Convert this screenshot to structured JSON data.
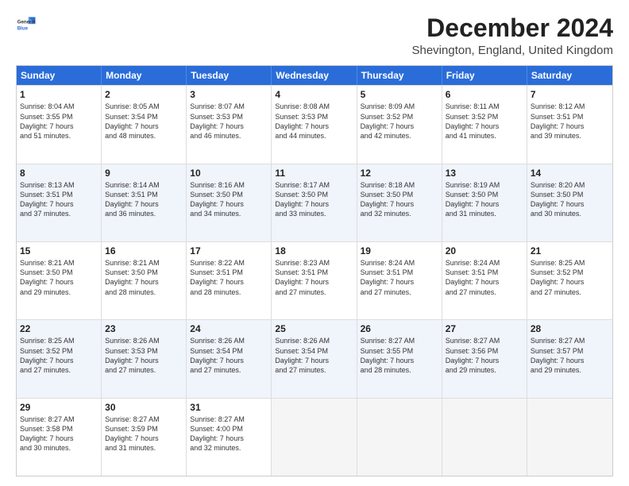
{
  "logo": {
    "line1": "General",
    "line2": "Blue"
  },
  "title": "December 2024",
  "subtitle": "Shevington, England, United Kingdom",
  "weekdays": [
    "Sunday",
    "Monday",
    "Tuesday",
    "Wednesday",
    "Thursday",
    "Friday",
    "Saturday"
  ],
  "weeks": [
    [
      {
        "day": "1",
        "lines": [
          "Sunrise: 8:04 AM",
          "Sunset: 3:55 PM",
          "Daylight: 7 hours",
          "and 51 minutes."
        ]
      },
      {
        "day": "2",
        "lines": [
          "Sunrise: 8:05 AM",
          "Sunset: 3:54 PM",
          "Daylight: 7 hours",
          "and 48 minutes."
        ]
      },
      {
        "day": "3",
        "lines": [
          "Sunrise: 8:07 AM",
          "Sunset: 3:53 PM",
          "Daylight: 7 hours",
          "and 46 minutes."
        ]
      },
      {
        "day": "4",
        "lines": [
          "Sunrise: 8:08 AM",
          "Sunset: 3:53 PM",
          "Daylight: 7 hours",
          "and 44 minutes."
        ]
      },
      {
        "day": "5",
        "lines": [
          "Sunrise: 8:09 AM",
          "Sunset: 3:52 PM",
          "Daylight: 7 hours",
          "and 42 minutes."
        ]
      },
      {
        "day": "6",
        "lines": [
          "Sunrise: 8:11 AM",
          "Sunset: 3:52 PM",
          "Daylight: 7 hours",
          "and 41 minutes."
        ]
      },
      {
        "day": "7",
        "lines": [
          "Sunrise: 8:12 AM",
          "Sunset: 3:51 PM",
          "Daylight: 7 hours",
          "and 39 minutes."
        ]
      }
    ],
    [
      {
        "day": "8",
        "lines": [
          "Sunrise: 8:13 AM",
          "Sunset: 3:51 PM",
          "Daylight: 7 hours",
          "and 37 minutes."
        ]
      },
      {
        "day": "9",
        "lines": [
          "Sunrise: 8:14 AM",
          "Sunset: 3:51 PM",
          "Daylight: 7 hours",
          "and 36 minutes."
        ]
      },
      {
        "day": "10",
        "lines": [
          "Sunrise: 8:16 AM",
          "Sunset: 3:50 PM",
          "Daylight: 7 hours",
          "and 34 minutes."
        ]
      },
      {
        "day": "11",
        "lines": [
          "Sunrise: 8:17 AM",
          "Sunset: 3:50 PM",
          "Daylight: 7 hours",
          "and 33 minutes."
        ]
      },
      {
        "day": "12",
        "lines": [
          "Sunrise: 8:18 AM",
          "Sunset: 3:50 PM",
          "Daylight: 7 hours",
          "and 32 minutes."
        ]
      },
      {
        "day": "13",
        "lines": [
          "Sunrise: 8:19 AM",
          "Sunset: 3:50 PM",
          "Daylight: 7 hours",
          "and 31 minutes."
        ]
      },
      {
        "day": "14",
        "lines": [
          "Sunrise: 8:20 AM",
          "Sunset: 3:50 PM",
          "Daylight: 7 hours",
          "and 30 minutes."
        ]
      }
    ],
    [
      {
        "day": "15",
        "lines": [
          "Sunrise: 8:21 AM",
          "Sunset: 3:50 PM",
          "Daylight: 7 hours",
          "and 29 minutes."
        ]
      },
      {
        "day": "16",
        "lines": [
          "Sunrise: 8:21 AM",
          "Sunset: 3:50 PM",
          "Daylight: 7 hours",
          "and 28 minutes."
        ]
      },
      {
        "day": "17",
        "lines": [
          "Sunrise: 8:22 AM",
          "Sunset: 3:51 PM",
          "Daylight: 7 hours",
          "and 28 minutes."
        ]
      },
      {
        "day": "18",
        "lines": [
          "Sunrise: 8:23 AM",
          "Sunset: 3:51 PM",
          "Daylight: 7 hours",
          "and 27 minutes."
        ]
      },
      {
        "day": "19",
        "lines": [
          "Sunrise: 8:24 AM",
          "Sunset: 3:51 PM",
          "Daylight: 7 hours",
          "and 27 minutes."
        ]
      },
      {
        "day": "20",
        "lines": [
          "Sunrise: 8:24 AM",
          "Sunset: 3:51 PM",
          "Daylight: 7 hours",
          "and 27 minutes."
        ]
      },
      {
        "day": "21",
        "lines": [
          "Sunrise: 8:25 AM",
          "Sunset: 3:52 PM",
          "Daylight: 7 hours",
          "and 27 minutes."
        ]
      }
    ],
    [
      {
        "day": "22",
        "lines": [
          "Sunrise: 8:25 AM",
          "Sunset: 3:52 PM",
          "Daylight: 7 hours",
          "and 27 minutes."
        ]
      },
      {
        "day": "23",
        "lines": [
          "Sunrise: 8:26 AM",
          "Sunset: 3:53 PM",
          "Daylight: 7 hours",
          "and 27 minutes."
        ]
      },
      {
        "day": "24",
        "lines": [
          "Sunrise: 8:26 AM",
          "Sunset: 3:54 PM",
          "Daylight: 7 hours",
          "and 27 minutes."
        ]
      },
      {
        "day": "25",
        "lines": [
          "Sunrise: 8:26 AM",
          "Sunset: 3:54 PM",
          "Daylight: 7 hours",
          "and 27 minutes."
        ]
      },
      {
        "day": "26",
        "lines": [
          "Sunrise: 8:27 AM",
          "Sunset: 3:55 PM",
          "Daylight: 7 hours",
          "and 28 minutes."
        ]
      },
      {
        "day": "27",
        "lines": [
          "Sunrise: 8:27 AM",
          "Sunset: 3:56 PM",
          "Daylight: 7 hours",
          "and 29 minutes."
        ]
      },
      {
        "day": "28",
        "lines": [
          "Sunrise: 8:27 AM",
          "Sunset: 3:57 PM",
          "Daylight: 7 hours",
          "and 29 minutes."
        ]
      }
    ],
    [
      {
        "day": "29",
        "lines": [
          "Sunrise: 8:27 AM",
          "Sunset: 3:58 PM",
          "Daylight: 7 hours",
          "and 30 minutes."
        ]
      },
      {
        "day": "30",
        "lines": [
          "Sunrise: 8:27 AM",
          "Sunset: 3:59 PM",
          "Daylight: 7 hours",
          "and 31 minutes."
        ]
      },
      {
        "day": "31",
        "lines": [
          "Sunrise: 8:27 AM",
          "Sunset: 4:00 PM",
          "Daylight: 7 hours",
          "and 32 minutes."
        ]
      },
      {
        "day": "",
        "lines": []
      },
      {
        "day": "",
        "lines": []
      },
      {
        "day": "",
        "lines": []
      },
      {
        "day": "",
        "lines": []
      }
    ]
  ]
}
